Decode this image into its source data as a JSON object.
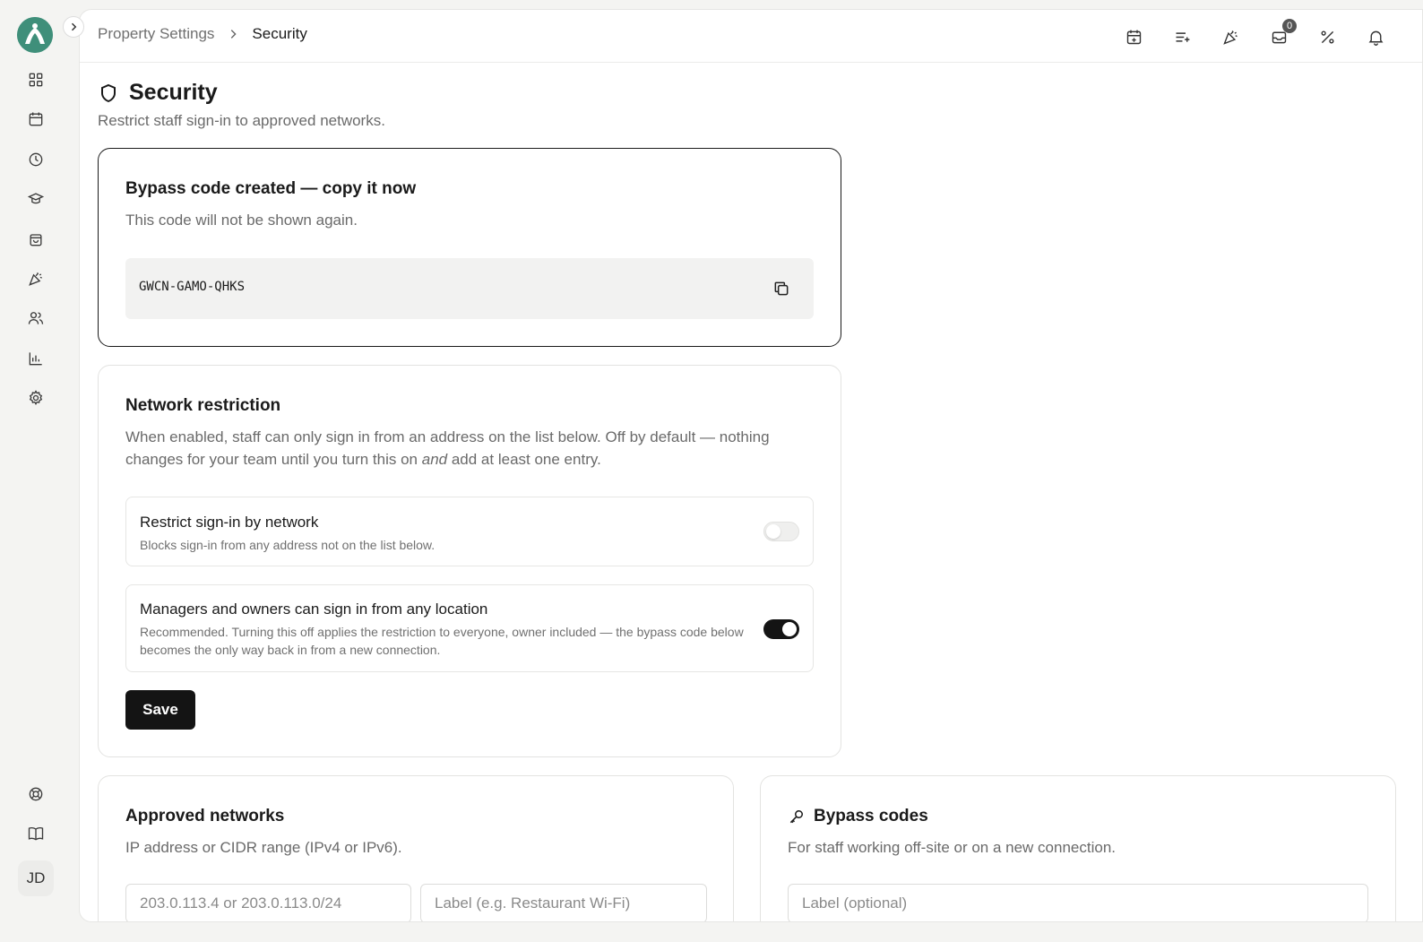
{
  "app": {
    "user_initials": "JD"
  },
  "sidebar": {
    "items": [
      {
        "name": "dashboard"
      },
      {
        "name": "calendar"
      },
      {
        "name": "history"
      },
      {
        "name": "training"
      },
      {
        "name": "shop"
      },
      {
        "name": "events"
      },
      {
        "name": "team"
      },
      {
        "name": "reports"
      },
      {
        "name": "settings"
      }
    ],
    "bottom": [
      {
        "name": "help"
      },
      {
        "name": "docs"
      }
    ]
  },
  "header": {
    "breadcrumb_parent": "Property Settings",
    "breadcrumb_current": "Security",
    "inbox_badge": "0"
  },
  "page": {
    "title": "Security",
    "subtitle": "Restrict staff sign-in to approved networks."
  },
  "bypass_created": {
    "title": "Bypass code created — copy it now",
    "description": "This code will not be shown again.",
    "code": "GWCN-GAMO-QHKS"
  },
  "network_restriction": {
    "title": "Network restriction",
    "desc_part1": "When enabled, staff can only sign in from an address on the list below. Off by default — nothing changes for your team until you turn this on ",
    "desc_em": "and",
    "desc_part2": " add at least one entry.",
    "options": [
      {
        "title": "Restrict sign-in by network",
        "description": "Blocks sign-in from any address not on the list below.",
        "enabled": false
      },
      {
        "title": "Managers and owners can sign in from any location",
        "description": "Recommended. Turning this off applies the restriction to everyone, owner included — the bypass code below becomes the only way back in from a new connection.",
        "enabled": true
      }
    ],
    "save_label": "Save"
  },
  "approved_networks": {
    "title": "Approved networks",
    "description": "IP address or CIDR range (IPv4 or IPv6).",
    "address_placeholder": "203.0.113.4 or 203.0.113.0/24",
    "label_placeholder": "Label (e.g. Restaurant Wi-Fi)"
  },
  "bypass_codes": {
    "title": "Bypass codes",
    "description": "For staff working off-site or on a new connection.",
    "label_placeholder": "Label (optional)"
  }
}
